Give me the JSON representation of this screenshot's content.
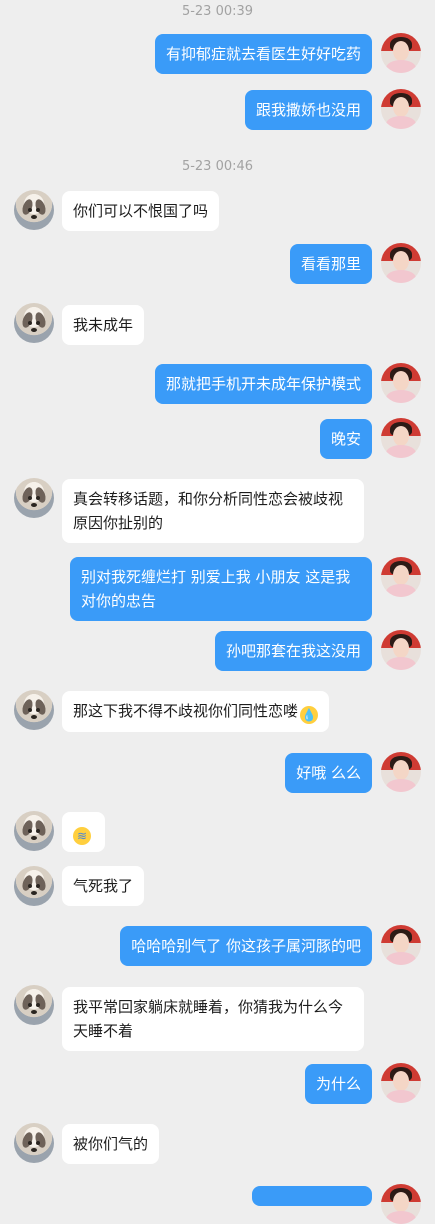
{
  "timestamps": [
    "5-23 00:39",
    "5-23 00:46"
  ],
  "messages": [
    {
      "side": "right",
      "text": "有抑郁症就去看医生好好吃药"
    },
    {
      "side": "right",
      "text": "跟我撒娇也没用"
    },
    {
      "side": "left",
      "text": "你们可以不恨国了吗"
    },
    {
      "side": "right",
      "text": "看看那里"
    },
    {
      "side": "left",
      "text": "我未成年"
    },
    {
      "side": "right",
      "text": "那就把手机开未成年保护模式"
    },
    {
      "side": "right",
      "text": "晚安"
    },
    {
      "side": "left",
      "text": "真会转移话题，和你分析同性恋会被歧视原因你扯别的"
    },
    {
      "side": "right",
      "text": "别对我死缠烂打 别爱上我 小朋友 这是我对你的忠告"
    },
    {
      "side": "right",
      "text": "孙吧那套在我这没用"
    },
    {
      "side": "left",
      "text": "那这下我不得不歧视你们同性恋喽",
      "emoji": "😰"
    },
    {
      "side": "right",
      "text": "好哦 么么"
    },
    {
      "side": "left",
      "text": "",
      "emoji": "😭"
    },
    {
      "side": "left",
      "text": "气死我了"
    },
    {
      "side": "right",
      "text": "哈哈哈别气了 你这孩子属河豚的吧"
    },
    {
      "side": "left",
      "text": "我平常回家躺床就睡着，你猜我为什么今天睡不着"
    },
    {
      "side": "right",
      "text": "为什么"
    },
    {
      "side": "left",
      "text": "被你们气的"
    }
  ],
  "avatars": {
    "left": "dog-avatar",
    "right": "girl-avatar"
  },
  "colors": {
    "background": "#eeeeee",
    "outgoing": "#3a9bf8",
    "incoming": "#ffffff"
  }
}
